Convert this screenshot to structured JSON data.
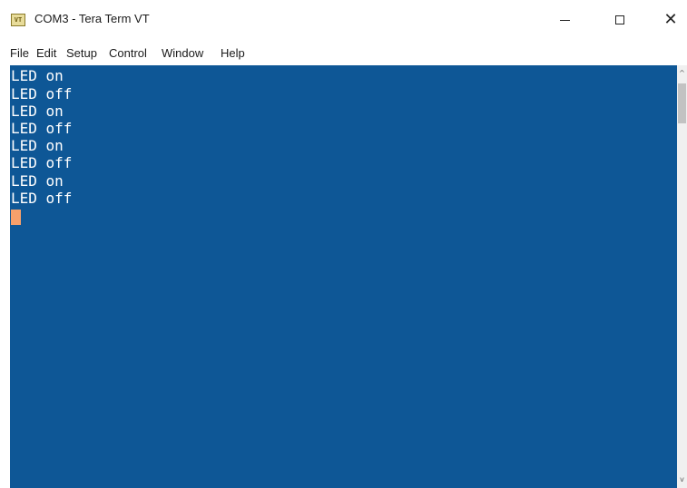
{
  "window": {
    "title": "COM3 - Tera Term VT",
    "icon": "tera-term-icon",
    "icon_label": "VT",
    "controls": {
      "minimize_icon": "minimize-icon",
      "maximize_icon": "maximize-icon",
      "close_icon": "close-icon",
      "close_glyph": "✕"
    }
  },
  "menu": {
    "items": [
      "File",
      "Edit",
      "Setup",
      "Control",
      "Window",
      "Help"
    ]
  },
  "terminal": {
    "lines": [
      "LED on",
      "LED off",
      "LED on",
      "LED off",
      "LED on",
      "LED off",
      "LED on",
      "LED off"
    ],
    "colors": {
      "background": "#0e5796",
      "foreground": "#ffffff",
      "cursor": "#f7a06b"
    }
  },
  "scrollbar": {
    "up_glyph": "^",
    "down_glyph": "v"
  }
}
